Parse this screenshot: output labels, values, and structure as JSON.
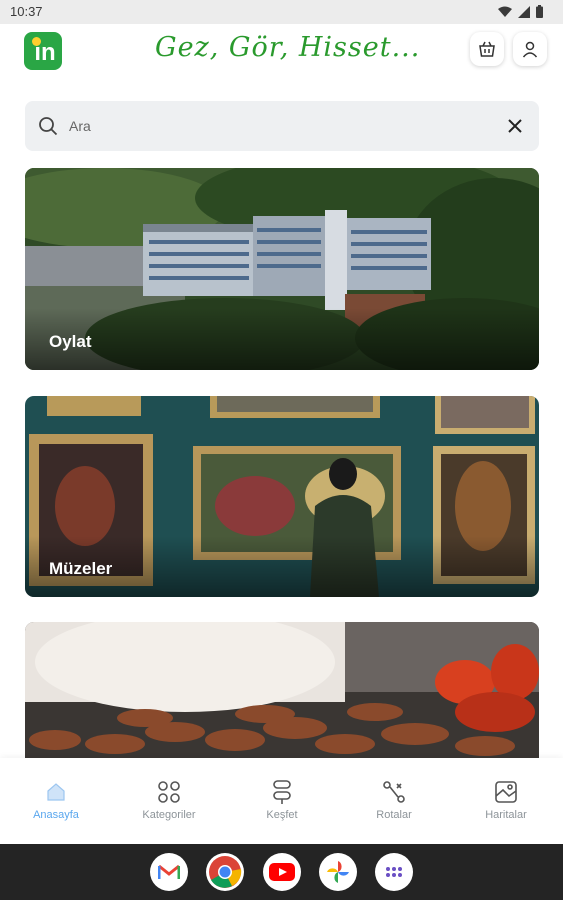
{
  "status_bar": {
    "time": "10:37"
  },
  "header": {
    "logo_text": "in",
    "slogan": "Gez, Gör, Hisset..."
  },
  "search": {
    "placeholder": "Ara"
  },
  "cards": [
    {
      "label": "Oylat"
    },
    {
      "label": "Müzeler"
    },
    {
      "label": ""
    }
  ],
  "bottom_nav": {
    "items": [
      {
        "label": "Anasayfa",
        "icon": "home-icon"
      },
      {
        "label": "Kategoriler",
        "icon": "grid-icon"
      },
      {
        "label": "Keşfet",
        "icon": "discover-icon"
      },
      {
        "label": "Rotalar",
        "icon": "route-icon"
      },
      {
        "label": "Haritalar",
        "icon": "map-icon"
      }
    ],
    "active_color": "#5aa7ee",
    "inactive_color": "#8d9499"
  },
  "system_apps": [
    "gmail-icon",
    "chrome-icon",
    "youtube-icon",
    "photos-icon",
    "app-drawer-icon"
  ],
  "colors": {
    "brand_green": "#2aa645",
    "slogan_green": "#2a9a2d"
  }
}
